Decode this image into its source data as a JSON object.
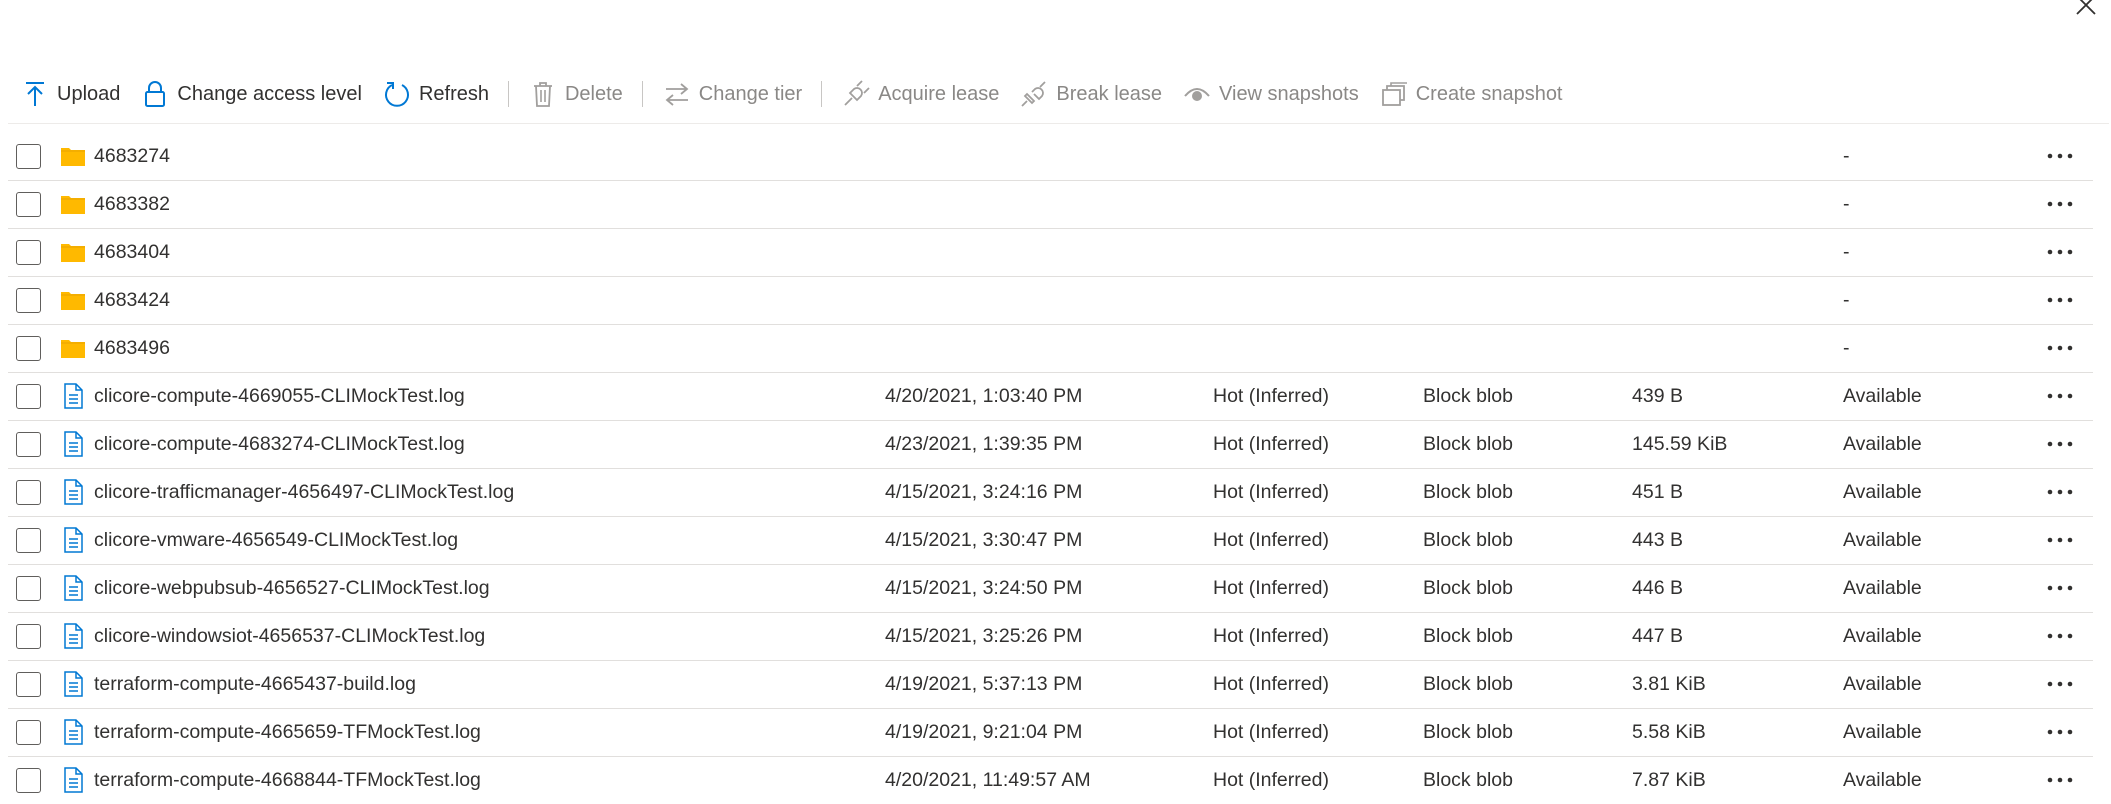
{
  "window": {
    "close_icon": "close-icon"
  },
  "toolbar": {
    "upload": "Upload",
    "change_access_level": "Change access level",
    "refresh": "Refresh",
    "delete": "Delete",
    "change_tier": "Change tier",
    "acquire_lease": "Acquire lease",
    "break_lease": "Break lease",
    "view_snapshots": "View snapshots",
    "create_snapshot": "Create snapshot"
  },
  "colors": {
    "accent": "#0078d4",
    "folder": "#ffb900",
    "disabled": "#8a8886",
    "text": "#323130"
  },
  "rows": [
    {
      "kind": "folder",
      "name": "4683274",
      "modified": "",
      "tier": "",
      "type": "",
      "size": "",
      "lease": "-"
    },
    {
      "kind": "folder",
      "name": "4683382",
      "modified": "",
      "tier": "",
      "type": "",
      "size": "",
      "lease": "-"
    },
    {
      "kind": "folder",
      "name": "4683404",
      "modified": "",
      "tier": "",
      "type": "",
      "size": "",
      "lease": "-"
    },
    {
      "kind": "folder",
      "name": "4683424",
      "modified": "",
      "tier": "",
      "type": "",
      "size": "",
      "lease": "-"
    },
    {
      "kind": "folder",
      "name": "4683496",
      "modified": "",
      "tier": "",
      "type": "",
      "size": "",
      "lease": "-"
    },
    {
      "kind": "file",
      "name": "clicore-compute-4669055-CLIMockTest.log",
      "modified": "4/20/2021, 1:03:40 PM",
      "tier": "Hot (Inferred)",
      "type": "Block blob",
      "size": "439 B",
      "lease": "Available"
    },
    {
      "kind": "file",
      "name": "clicore-compute-4683274-CLIMockTest.log",
      "modified": "4/23/2021, 1:39:35 PM",
      "tier": "Hot (Inferred)",
      "type": "Block blob",
      "size": "145.59 KiB",
      "lease": "Available"
    },
    {
      "kind": "file",
      "name": "clicore-trafficmanager-4656497-CLIMockTest.log",
      "modified": "4/15/2021, 3:24:16 PM",
      "tier": "Hot (Inferred)",
      "type": "Block blob",
      "size": "451 B",
      "lease": "Available"
    },
    {
      "kind": "file",
      "name": "clicore-vmware-4656549-CLIMockTest.log",
      "modified": "4/15/2021, 3:30:47 PM",
      "tier": "Hot (Inferred)",
      "type": "Block blob",
      "size": "443 B",
      "lease": "Available"
    },
    {
      "kind": "file",
      "name": "clicore-webpubsub-4656527-CLIMockTest.log",
      "modified": "4/15/2021, 3:24:50 PM",
      "tier": "Hot (Inferred)",
      "type": "Block blob",
      "size": "446 B",
      "lease": "Available"
    },
    {
      "kind": "file",
      "name": "clicore-windowsiot-4656537-CLIMockTest.log",
      "modified": "4/15/2021, 3:25:26 PM",
      "tier": "Hot (Inferred)",
      "type": "Block blob",
      "size": "447 B",
      "lease": "Available"
    },
    {
      "kind": "file",
      "name": "terraform-compute-4665437-build.log",
      "modified": "4/19/2021, 5:37:13 PM",
      "tier": "Hot (Inferred)",
      "type": "Block blob",
      "size": "3.81 KiB",
      "lease": "Available"
    },
    {
      "kind": "file",
      "name": "terraform-compute-4665659-TFMockTest.log",
      "modified": "4/19/2021, 9:21:04 PM",
      "tier": "Hot (Inferred)",
      "type": "Block blob",
      "size": "5.58 KiB",
      "lease": "Available"
    },
    {
      "kind": "file",
      "name": "terraform-compute-4668844-TFMockTest.log",
      "modified": "4/20/2021, 11:49:57 AM",
      "tier": "Hot (Inferred)",
      "type": "Block blob",
      "size": "7.87 KiB",
      "lease": "Available"
    }
  ]
}
